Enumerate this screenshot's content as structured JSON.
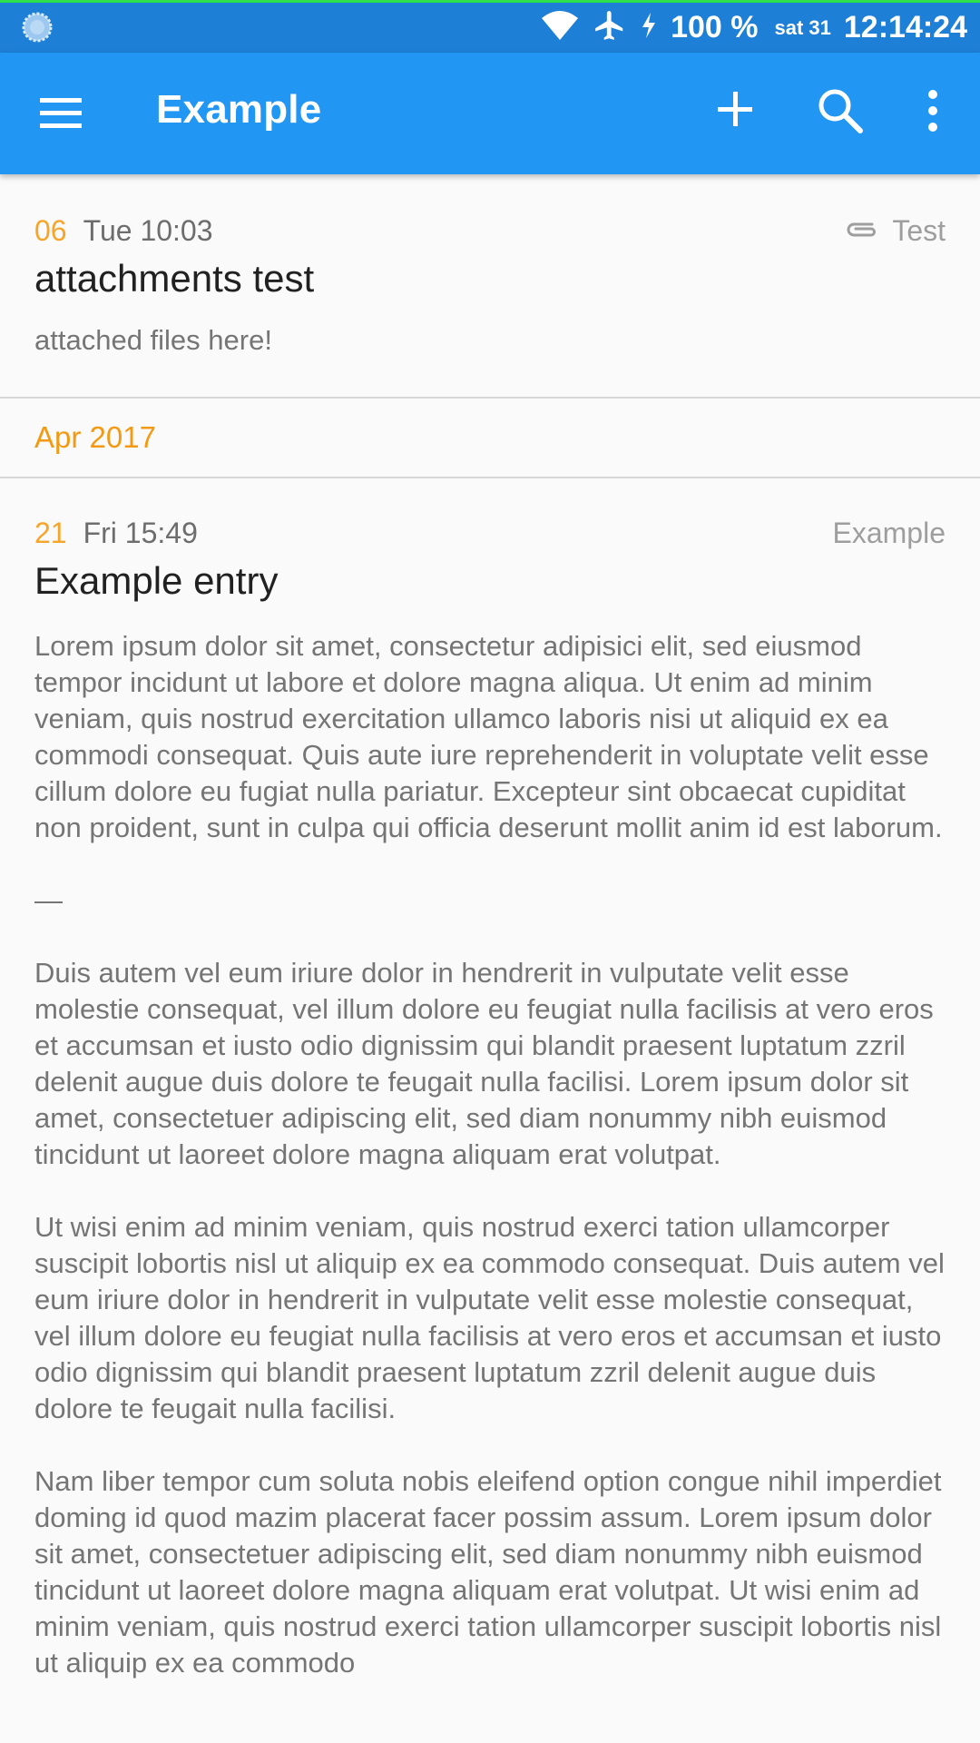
{
  "status_bar": {
    "battery": "100 %",
    "date": "sat 31",
    "time": "12:14:24"
  },
  "app_bar": {
    "title": "Example",
    "icons": [
      "menu-icon",
      "add-icon",
      "search-icon",
      "more-vert-icon"
    ]
  },
  "entries": [
    {
      "day": "06",
      "time": "Tue 10:03",
      "tag": "Test",
      "title": "attachments test",
      "body": "attached files here!"
    },
    {
      "day": "21",
      "time": "Fri 15:49",
      "tag": "Example",
      "title": "Example entry",
      "paragraphs": [
        "Lorem ipsum dolor sit amet, consectetur adipisici elit, sed eiusmod tempor incidunt ut labore et dolore magna aliqua. Ut enim ad minim veniam, quis nostrud exercitation ullamco laboris nisi ut aliquid ex ea commodi consequat. Quis aute iure reprehenderit in voluptate velit esse cillum dolore eu fugiat nulla pariatur. Excepteur sint obcaecat cupiditat non proident, sunt in culpa qui officia deserunt mollit anim id est laborum.",
        "—",
        "Duis autem vel eum iriure dolor in hendrerit in vulputate velit esse molestie consequat, vel illum dolore eu feugiat nulla facilisis at vero eros et accumsan et iusto odio dignissim qui blandit praesent luptatum zzril delenit augue duis dolore te feugait nulla facilisi. Lorem ipsum dolor sit amet, consectetuer adipiscing elit, sed diam nonummy nibh euismod tincidunt ut laoreet dolore magna aliquam erat volutpat.",
        "Ut wisi enim ad minim veniam, quis nostrud exerci tation ullamcorper suscipit lobortis nisl ut aliquip ex ea commodo consequat. Duis autem vel eum iriure dolor in hendrerit in vulputate velit esse molestie consequat, vel illum dolore eu feugiat nulla facilisis at vero eros et accumsan et iusto odio dignissim qui blandit praesent luptatum zzril delenit augue duis dolore te feugait nulla facilisi.",
        "Nam liber tempor cum soluta nobis eleifend option congue nihil imperdiet doming id quod mazim placerat facer possim assum. Lorem ipsum dolor sit amet, consectetuer adipiscing elit, sed diam nonummy nibh euismod tincidunt ut laoreet dolore magna aliquam erat volutpat. Ut wisi enim ad minim veniam, quis nostrud exerci tation ullamcorper suscipit lobortis nisl ut aliquip ex ea commodo"
      ]
    }
  ],
  "month_header": "Apr 2017",
  "colors": {
    "status_bar": "#1e7fd6",
    "app_bar": "#2196f3",
    "accent_orange": "#f39a12"
  }
}
